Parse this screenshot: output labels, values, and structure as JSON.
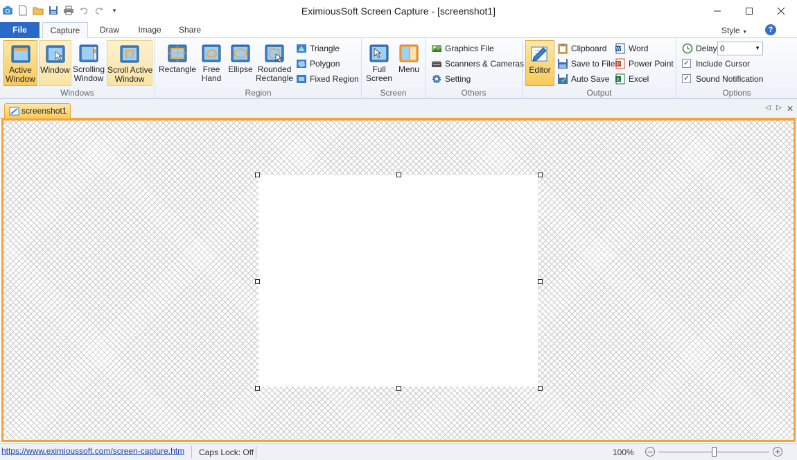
{
  "window": {
    "title": "EximiousSoft Screen Capture - [screenshot1]",
    "minimize_icon": "minimize-icon",
    "maximize_icon": "maximize-icon",
    "close_icon": "close-icon"
  },
  "tabs": {
    "file": "File",
    "items": [
      "Capture",
      "Draw",
      "Image",
      "Share"
    ],
    "active": "Capture",
    "style": "Style"
  },
  "ribbon": {
    "windows": {
      "label": "Windows",
      "buttons": [
        "Active\nWindow",
        "Window",
        "Scrolling\nWindow",
        "Scroll Active\nWindow"
      ]
    },
    "region": {
      "label": "Region",
      "buttons": [
        "Rectangle",
        "Free\nHand",
        "Ellipse",
        "Rounded\nRectangle"
      ],
      "small": [
        "Triangle",
        "Polygon",
        "Fixed Region"
      ]
    },
    "screen": {
      "label": "Screen",
      "buttons": [
        "Full\nScreen",
        "Menu"
      ]
    },
    "others": {
      "label": "Others",
      "items": [
        "Graphics File",
        "Scanners & Cameras",
        "Setting"
      ]
    },
    "output": {
      "label": "Output",
      "editor": "Editor",
      "items": [
        "Clipboard",
        "Save to File",
        "Auto Save"
      ],
      "items2": [
        "Word",
        "Power Point",
        "Excel"
      ]
    },
    "options": {
      "label": "Options",
      "delay_label": "Delay",
      "delay_value": "0",
      "include_cursor": "Include Cursor",
      "sound_notification": "Sound Notification",
      "include_cursor_checked": true,
      "sound_notification_checked": true
    }
  },
  "document": {
    "tab": "screenshot1"
  },
  "status": {
    "link": "https://www.eximioussoft.com/screen-capture.htm",
    "caps_lock": "Caps Lock: Off",
    "zoom": "100%",
    "zoom_fraction": 0.5
  },
  "colors": {
    "accent": "#2a6ac6",
    "selection": "#f8c95a",
    "canvas_border": "#f6a23a"
  }
}
